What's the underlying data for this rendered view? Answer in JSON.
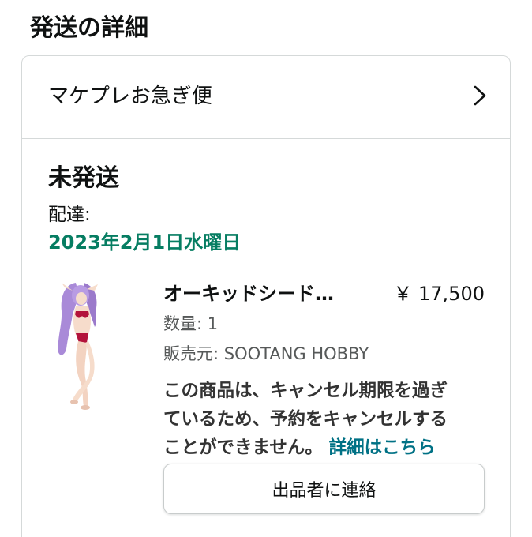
{
  "section": {
    "title": "発送の詳細"
  },
  "shipping_method": {
    "label": "マケプレお急ぎ便",
    "icon": "chevron-right-icon"
  },
  "shipment": {
    "status": "未発送",
    "delivery_label": "配達:",
    "delivery_date": "2023年2月1日水曜日",
    "date_color": "#067d62"
  },
  "item": {
    "name": "オーキッドシード…",
    "price": "￥ 17,500",
    "quantity": "数量: 1",
    "seller": "販売元: SOOTANG HOBBY",
    "notice_line1": "この商品は、キャンセル期限を過ぎ",
    "notice_line2": "ているため、予約をキャンセルする",
    "notice_line3": "ことができません。",
    "details_link": "詳細はこちら",
    "link_color": "#007185"
  },
  "actions": {
    "contact_seller": "出品者に連絡"
  }
}
